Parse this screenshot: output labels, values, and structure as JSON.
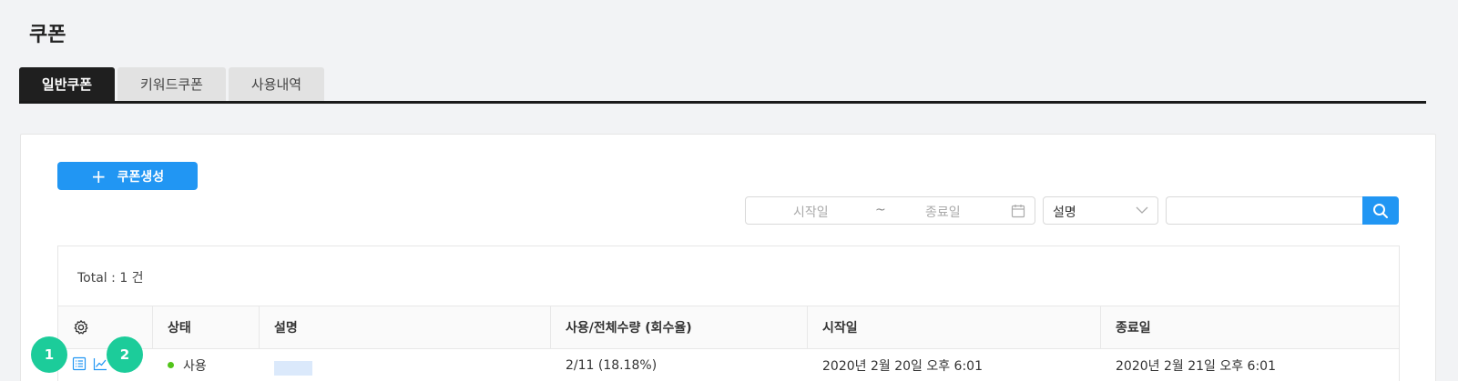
{
  "page": {
    "title": "쿠폰"
  },
  "tabs": [
    {
      "label": "일반쿠폰",
      "active": true
    },
    {
      "label": "키워드쿠폰",
      "active": false
    },
    {
      "label": "사용내역",
      "active": false
    }
  ],
  "toolbar": {
    "create_label": "쿠폰생성",
    "create_icon": "+"
  },
  "filters": {
    "start_placeholder": "시작일",
    "separator": "~",
    "end_placeholder": "종료일",
    "select_value": "설명",
    "search_value": ""
  },
  "table": {
    "total": "Total : 1 건",
    "headers": [
      "상태",
      "설명",
      "사용/전체수량 (회수율)",
      "시작일",
      "종료일"
    ],
    "rows": [
      {
        "status": "사용",
        "usage": "2/11 (18.18%)",
        "start": "2020년 2월 20일 오후 6:01",
        "end": "2020년 2월 21일 오후 6:01"
      }
    ]
  },
  "badges": [
    "1",
    "2"
  ],
  "colors": {
    "primary": "#2196f3",
    "active_tab": "#1f1f1f",
    "status_active": "#52c41a",
    "badge": "#1ccc9a"
  }
}
